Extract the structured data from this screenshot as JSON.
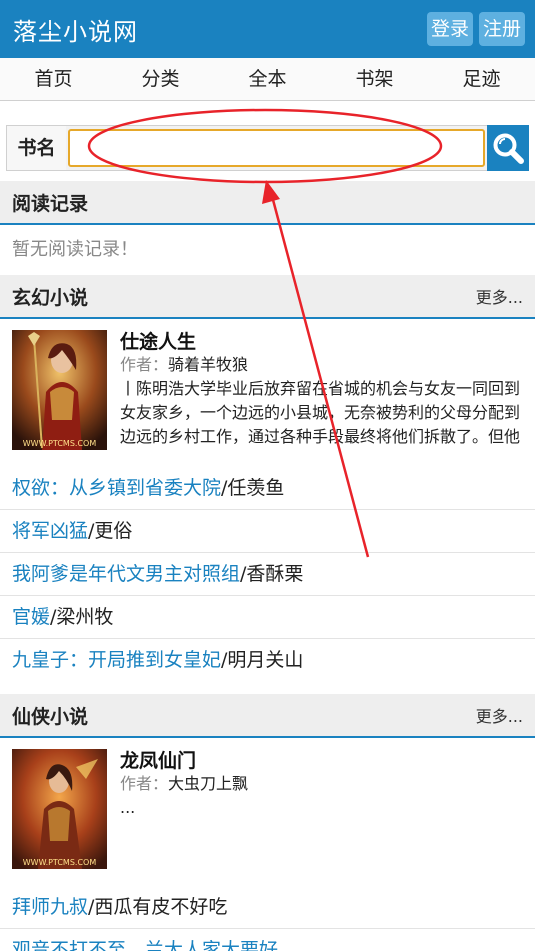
{
  "header": {
    "title": "落尘小说网",
    "login": "登录",
    "register": "注册"
  },
  "nav": [
    "首页",
    "分类",
    "全本",
    "书架",
    "足迹"
  ],
  "search": {
    "label": "书名",
    "value": "",
    "placeholder": ""
  },
  "reading": {
    "title": "阅读记录",
    "empty": "暂无阅读记录！"
  },
  "xuanhuan": {
    "title": "玄幻小说",
    "more": "更多...",
    "feature": {
      "title": "仕途人生",
      "author_label": "作者：",
      "author": "骑着羊牧狼",
      "desc": "丨陈明浩大学毕业后放弃留在省城的机会与女友一同回到女友家乡，一个边远的小县城，无奈被势利的父母分配到边远的乡村工作，通过各种手段最终将他们拆散了。但他",
      "cover_watermark": "WWW.PTCMS.COM"
    },
    "books": [
      {
        "title": "权欲：从乡镇到省委大院",
        "author": "任羡鱼"
      },
      {
        "title": "将军凶猛",
        "author": "更俗"
      },
      {
        "title": "我阿爹是年代文男主对照组",
        "author": "香酥栗"
      },
      {
        "title": "官媛",
        "author": "梁州牧"
      },
      {
        "title": "九皇子：开局推到女皇妃",
        "author": "明月关山"
      }
    ]
  },
  "xianxia": {
    "title": "仙侠小说",
    "more": "更多...",
    "feature": {
      "title": "龙凤仙门",
      "author_label": "作者：",
      "author": "大虫刀上飘",
      "desc": "...",
      "cover_watermark": "WWW.PTCMS.COM"
    },
    "books": [
      {
        "title": "拜师九叔",
        "author": "西瓜有皮不好吃"
      },
      {
        "title": "观音不打不至，兰大人家大要好",
        "author": ""
      }
    ]
  },
  "separator": "/",
  "colors": {
    "primary": "#1a82c0",
    "annotation": "#e8232a",
    "input_border": "#e6a82a"
  }
}
